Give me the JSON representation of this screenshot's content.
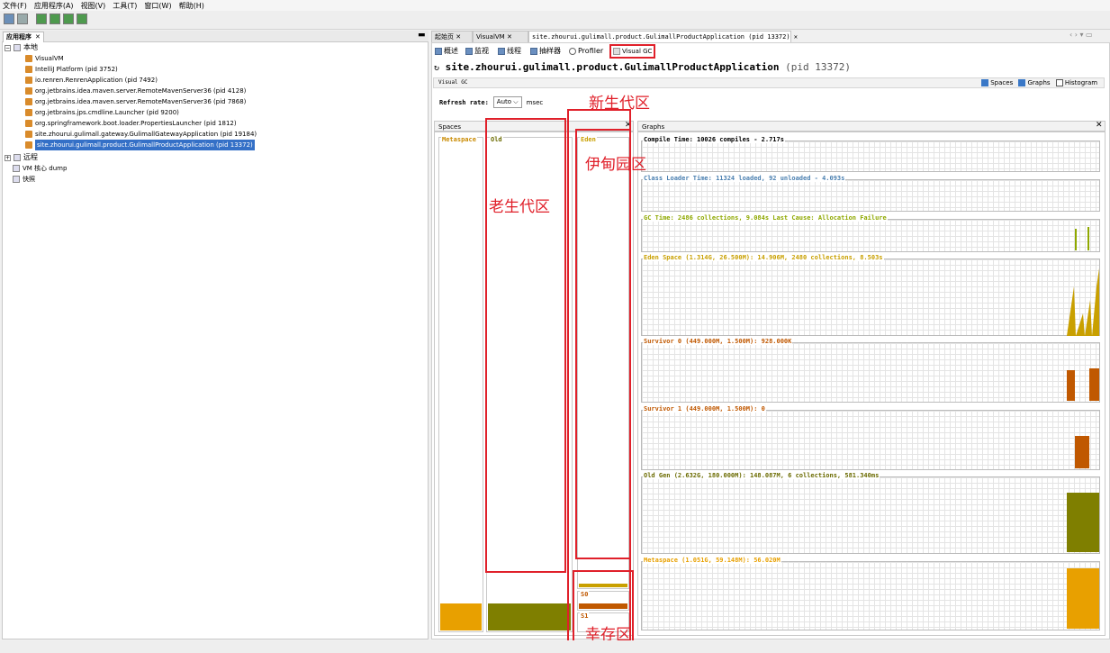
{
  "menu": [
    "文件(F)",
    "应用程序(A)",
    "视图(V)",
    "工具(T)",
    "窗口(W)",
    "帮助(H)"
  ],
  "left_panel": {
    "tab_label": "应用程序",
    "tree": {
      "local": "本地",
      "items": [
        "VisualVM",
        "IntelliJ Platform (pid 3752)",
        "io.renren.RenrenApplication (pid 7492)",
        "org.jetbrains.idea.maven.server.RemoteMavenServer36 (pid 4128)",
        "org.jetbrains.idea.maven.server.RemoteMavenServer36 (pid 7868)",
        "org.jetbrains.jps.cmdline.Launcher (pid 9200)",
        "org.springframework.boot.loader.PropertiesLauncher (pid 1812)",
        "site.zhourui.gulimall.gateway.GulimallGatewayApplication (pid 19184)",
        "site.zhourui.gulimall.product.GulimallProductApplication (pid 13372)"
      ],
      "remote": "远程",
      "vm_dump": "VM 核心 dump",
      "snapshots": "快照"
    }
  },
  "tabs": [
    "起始页",
    "VisualVM",
    "site.zhourui.gulimall.product.GulimallProductApplication (pid 13372)"
  ],
  "subtabs": [
    "概述",
    "监视",
    "线程",
    "抽样器",
    "Profiler",
    "Visual GC"
  ],
  "app": {
    "title": "site.zhourui.gulimall.product.GulimallProductApplication",
    "pid": "(pid 13372)"
  },
  "visual_gc": {
    "label": "Visual GC",
    "refresh_label": "Refresh rate:",
    "refresh_value": "Auto",
    "refresh_unit": "msec",
    "checkboxes": [
      {
        "label": "Spaces",
        "checked": true
      },
      {
        "label": "Graphs",
        "checked": true
      },
      {
        "label": "Histogram",
        "checked": false
      }
    ]
  },
  "spaces": {
    "header": "Spaces",
    "metaspace": "Metaspace",
    "old": "Old",
    "eden": "Eden",
    "s0": "S0",
    "s1": "S1",
    "metaspace_fill": 0.19,
    "old_fill": 0.19,
    "eden_fill": 0.02,
    "s0_fill": 0.6,
    "s1_fill": 0.0
  },
  "graphs": {
    "header": "Graphs",
    "rows": [
      {
        "label": "Compile Time: 10026 compiles - 2.717s",
        "color": "#000000"
      },
      {
        "label": "Class Loader Time: 11324 loaded, 92 unloaded - 4.093s",
        "color": "#4a7fb0"
      },
      {
        "label": "GC Time: 2486 collections, 9.084s  Last Cause: Allocation Failure",
        "color": "#8fa800"
      },
      {
        "label": "Eden Space (1.314G, 26.500M): 14.906M, 2480 collections, 8.503s",
        "color": "#d4a000"
      },
      {
        "label": "Survivor 0 (449.000M, 1.500M): 928.000K",
        "color": "#c05800"
      },
      {
        "label": "Survivor 1 (449.000M, 1.500M): 0",
        "color": "#c05800"
      },
      {
        "label": "Old Gen (2.632G, 180.000M): 148.087M, 6 collections, 581.340ms",
        "color": "#6b6b00"
      },
      {
        "label": "Metaspace (1.051G, 59.148M): 56.020M",
        "color": "#e89800"
      }
    ]
  },
  "annotations": {
    "young_gen": "新生代区",
    "eden": "伊甸园区",
    "old_gen": "老生代区",
    "survivor": "幸存区"
  },
  "colors": {
    "metaspace": "#e8a000",
    "old": "#7f7f00",
    "eden": "#c9a000",
    "survivor": "#c05800",
    "annotation": "#e0202a",
    "selection": "#3470c7"
  }
}
